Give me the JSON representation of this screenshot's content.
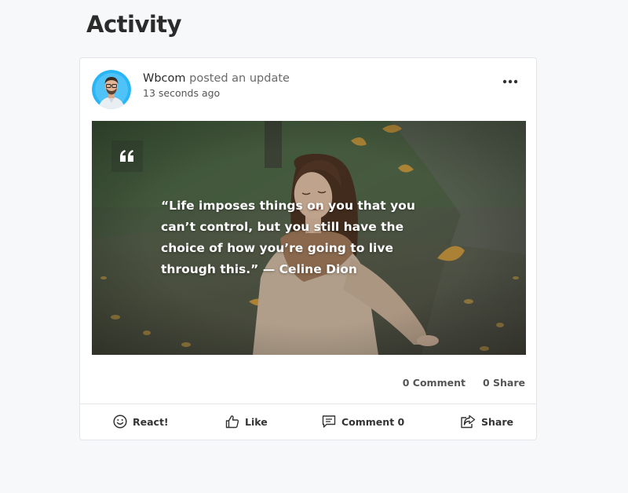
{
  "page": {
    "title": "Activity"
  },
  "post": {
    "author": "Wbcom",
    "action": "posted an update",
    "timestamp": "13 seconds ago",
    "quote": "“Life imposes things on you that you can’t control, but you still have the choice of how you’re going to live through this.” — Celine Dion",
    "quote_icon": "quote-icon",
    "more_icon": "ellipsis-icon",
    "counts": {
      "comments": "0 Comment",
      "shares": "0 Share"
    },
    "actions": {
      "react": {
        "label": "React!",
        "icon": "smile-icon"
      },
      "like": {
        "label": "Like",
        "icon": "thumbs-up-icon"
      },
      "comment": {
        "label": "Comment 0",
        "icon": "comment-icon"
      },
      "share": {
        "label": "Share",
        "icon": "share-icon"
      }
    }
  },
  "colors": {
    "background": "#f7f8fa",
    "card": "#ffffff",
    "border": "#e3e5e8",
    "avatar_ring": "#29b6f6",
    "text": "#2a2a2a"
  }
}
